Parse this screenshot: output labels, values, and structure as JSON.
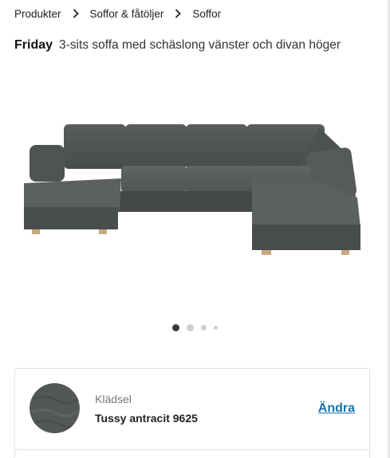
{
  "breadcrumb": {
    "items": [
      "Produkter",
      "Soffor & fåtöljer",
      "Soffor"
    ]
  },
  "product": {
    "name": "Friday",
    "description": "3-sits soffa med schäslong vänster och divan höger"
  },
  "gallery": {
    "image_alt": "sofa-image",
    "slides_total": 4,
    "active_slide": 1
  },
  "options": {
    "fabric_label": "Klädsel",
    "fabric_value": "Tussy antracit 9625",
    "change_label": "Ändra"
  },
  "colors": {
    "fabric": "#545758",
    "link": "#1a73a8"
  }
}
